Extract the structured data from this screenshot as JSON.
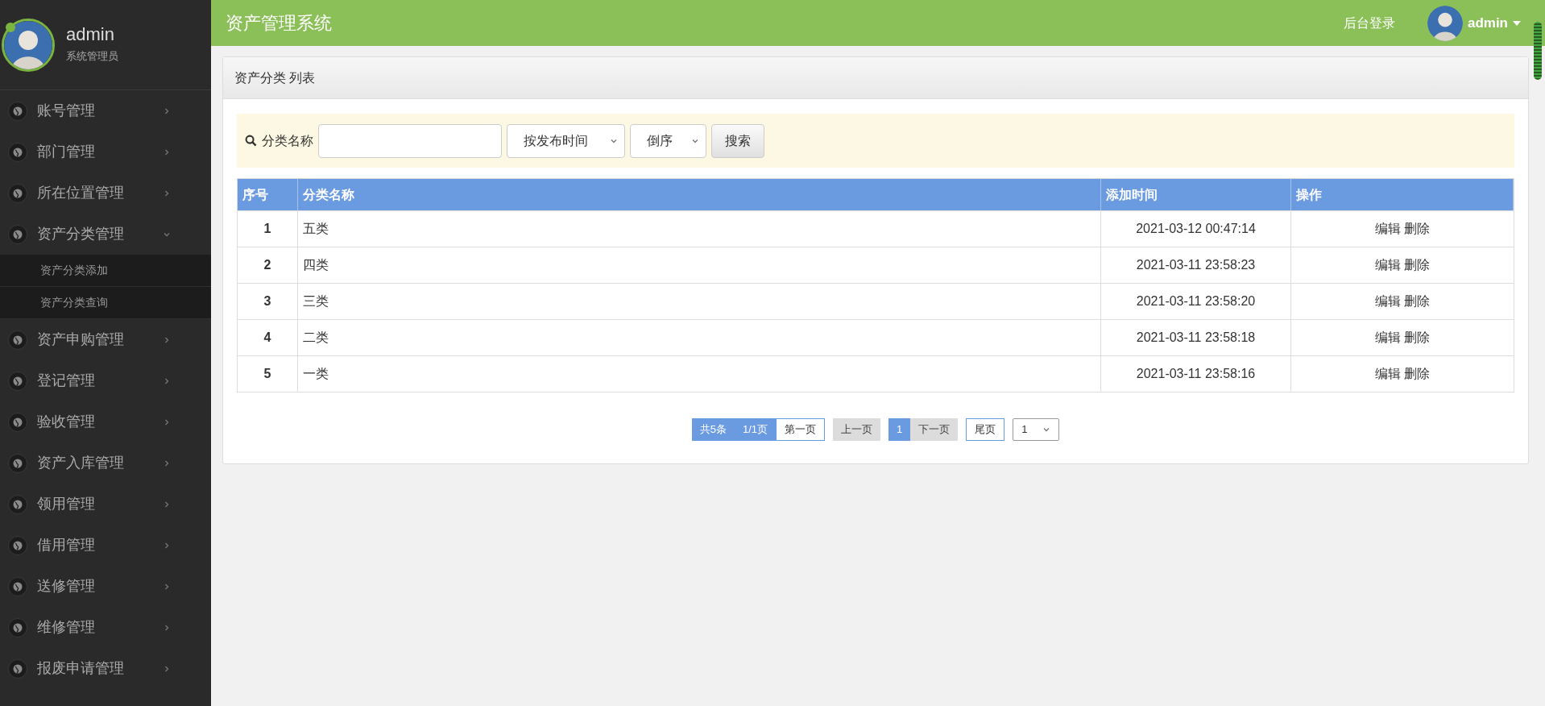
{
  "sidebar": {
    "user": {
      "name": "admin",
      "role": "系统管理员",
      "online": true
    },
    "items": [
      {
        "label": "账号管理",
        "expanded": false
      },
      {
        "label": "部门管理",
        "expanded": false
      },
      {
        "label": "所在位置管理",
        "expanded": false
      },
      {
        "label": "资产分类管理",
        "expanded": true,
        "children": [
          {
            "label": "资产分类添加"
          },
          {
            "label": "资产分类查询"
          }
        ]
      },
      {
        "label": "资产申购管理",
        "expanded": false
      },
      {
        "label": "登记管理",
        "expanded": false
      },
      {
        "label": "验收管理",
        "expanded": false
      },
      {
        "label": "资产入库管理",
        "expanded": false
      },
      {
        "label": "领用管理",
        "expanded": false
      },
      {
        "label": "借用管理",
        "expanded": false
      },
      {
        "label": "送修管理",
        "expanded": false
      },
      {
        "label": "维修管理",
        "expanded": false
      },
      {
        "label": "报废申请管理",
        "expanded": false
      }
    ]
  },
  "header": {
    "title": "资产管理系统",
    "login_link": "后台登录",
    "user": "admin"
  },
  "panel": {
    "title": "资产分类 列表",
    "search": {
      "label": "分类名称",
      "sort_field": "按发布时间",
      "sort_order": "倒序",
      "button": "搜索"
    },
    "table": {
      "columns": [
        "序号",
        "分类名称",
        "添加时间",
        "操作"
      ],
      "rows": [
        {
          "index": "1",
          "name": "五类",
          "time": "2021-03-12 00:47:14",
          "actions": [
            "编辑",
            "删除"
          ]
        },
        {
          "index": "2",
          "name": "四类",
          "time": "2021-03-11 23:58:23",
          "actions": [
            "编辑",
            "删除"
          ]
        },
        {
          "index": "3",
          "name": "三类",
          "time": "2021-03-11 23:58:20",
          "actions": [
            "编辑",
            "删除"
          ]
        },
        {
          "index": "4",
          "name": "二类",
          "time": "2021-03-11 23:58:18",
          "actions": [
            "编辑",
            "删除"
          ]
        },
        {
          "index": "5",
          "name": "一类",
          "time": "2021-03-11 23:58:16",
          "actions": [
            "编辑",
            "删除"
          ]
        }
      ]
    },
    "pager": {
      "items": [
        {
          "label": "共5条",
          "kind": "info"
        },
        {
          "label": "1/1页",
          "kind": "info"
        },
        {
          "label": "第一页",
          "kind": "link"
        },
        {
          "label": "上一页",
          "kind": "disabled"
        },
        {
          "label": "1",
          "kind": "current"
        },
        {
          "label": "下一页",
          "kind": "disabled"
        },
        {
          "label": "尾页",
          "kind": "link"
        }
      ],
      "page_select": "1"
    }
  }
}
